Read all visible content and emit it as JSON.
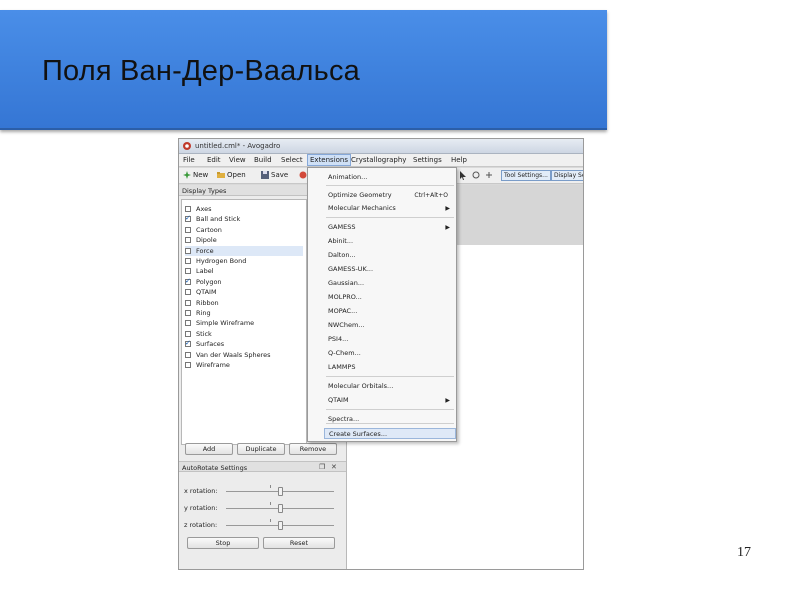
{
  "slide": {
    "title": "Поля Ван-Дер-Ваальса",
    "page_number": "17",
    "header_color": "#3f82de"
  },
  "app": {
    "window_title": "untitled.cml* - Avogadro",
    "menu": [
      "File",
      "Edit",
      "View",
      "Build",
      "Select",
      "Extensions",
      "Crystallography",
      "Settings",
      "Help"
    ],
    "toolbar": {
      "new_label": "New",
      "open_label": "Open",
      "save_label": "Save",
      "tool_settings_label": "Tool Settings...",
      "display_settings_label": "Display Se"
    },
    "display_types": {
      "title": "Display Types",
      "items": [
        {
          "label": "Axes",
          "checked": false
        },
        {
          "label": "Ball and Stick",
          "checked": true
        },
        {
          "label": "Cartoon",
          "checked": false
        },
        {
          "label": "Dipole",
          "checked": false
        },
        {
          "label": "Force",
          "checked": false
        },
        {
          "label": "Hydrogen Bond",
          "checked": false
        },
        {
          "label": "Label",
          "checked": false
        },
        {
          "label": "Polygon",
          "checked": true
        },
        {
          "label": "QTAIM",
          "checked": false
        },
        {
          "label": "Ribbon",
          "checked": false
        },
        {
          "label": "Ring",
          "checked": false
        },
        {
          "label": "Simple Wireframe",
          "checked": false
        },
        {
          "label": "Stick",
          "checked": false
        },
        {
          "label": "Surfaces",
          "checked": true
        },
        {
          "label": "Van der Waals Spheres",
          "checked": false
        },
        {
          "label": "Wireframe",
          "checked": false
        }
      ],
      "buttons": [
        "Add",
        "Duplicate",
        "Remove"
      ]
    },
    "auto_rotate": {
      "title": "AutoRotate Settings",
      "rows": [
        {
          "label": "x rotation:",
          "value": 0.5
        },
        {
          "label": "y rotation:",
          "value": 0.5
        },
        {
          "label": "z rotation:",
          "value": 0.5
        }
      ],
      "stop_label": "Stop",
      "reset_label": "Reset"
    },
    "extensions_menu": {
      "items": [
        {
          "label": "Animation...",
          "shortcut": "",
          "submenu": false
        },
        {
          "label": "Optimize Geometry",
          "shortcut": "Ctrl+Alt+O",
          "submenu": false
        },
        {
          "label": "Molecular Mechanics",
          "shortcut": "",
          "submenu": true
        },
        {
          "label": "GAMESS",
          "shortcut": "",
          "submenu": true
        },
        {
          "label": "Abinit...",
          "shortcut": "",
          "submenu": false
        },
        {
          "label": "Dalton...",
          "shortcut": "",
          "submenu": false
        },
        {
          "label": "GAMESS-UK...",
          "shortcut": "",
          "submenu": false
        },
        {
          "label": "Gaussian...",
          "shortcut": "",
          "submenu": false
        },
        {
          "label": "MOLPRO...",
          "shortcut": "",
          "submenu": false
        },
        {
          "label": "MOPAC...",
          "shortcut": "",
          "submenu": false
        },
        {
          "label": "NWChem...",
          "shortcut": "",
          "submenu": false
        },
        {
          "label": "PSI4...",
          "shortcut": "",
          "submenu": false
        },
        {
          "label": "Q-Chem...",
          "shortcut": "",
          "submenu": false
        },
        {
          "label": "LAMMPS",
          "shortcut": "",
          "submenu": false
        },
        {
          "label": "Molecular Orbitals...",
          "shortcut": "",
          "submenu": false
        },
        {
          "label": "QTAIM",
          "shortcut": "",
          "submenu": true
        },
        {
          "label": "Spectra...",
          "shortcut": "",
          "submenu": false
        },
        {
          "label": "Create Surfaces...",
          "shortcut": "",
          "submenu": false
        }
      ]
    }
  }
}
